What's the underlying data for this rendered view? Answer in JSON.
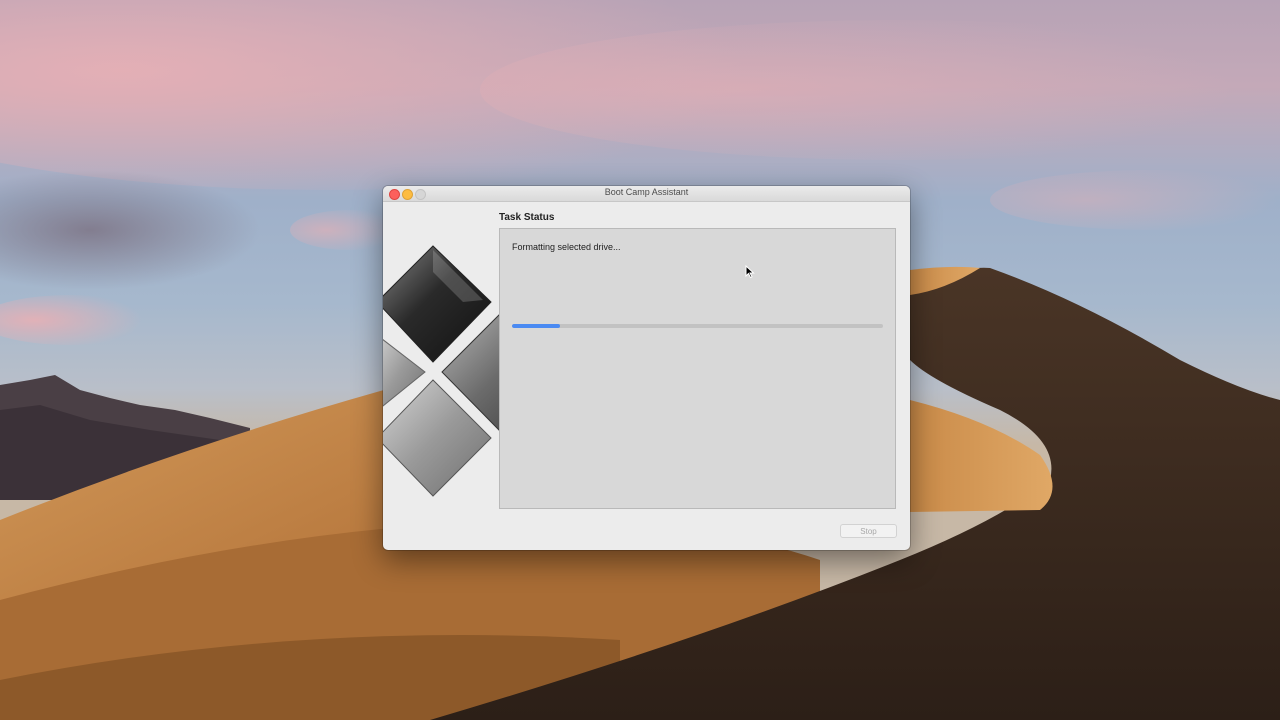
{
  "window": {
    "title": "Boot Camp Assistant",
    "task_status_label": "Task Status",
    "status_message": "Formatting selected drive...",
    "progress_fraction": 0.13,
    "stop_label": "Stop",
    "stop_enabled": false
  },
  "colors": {
    "progress_fill": "#4a8af2",
    "close_button": "#fc605c",
    "minimize_button": "#fdbc40",
    "zoom_button": "#d6d6d6"
  },
  "icons": [
    "close-icon",
    "minimize-icon",
    "zoom-icon",
    "boot-camp-logo",
    "mouse-cursor-icon"
  ]
}
